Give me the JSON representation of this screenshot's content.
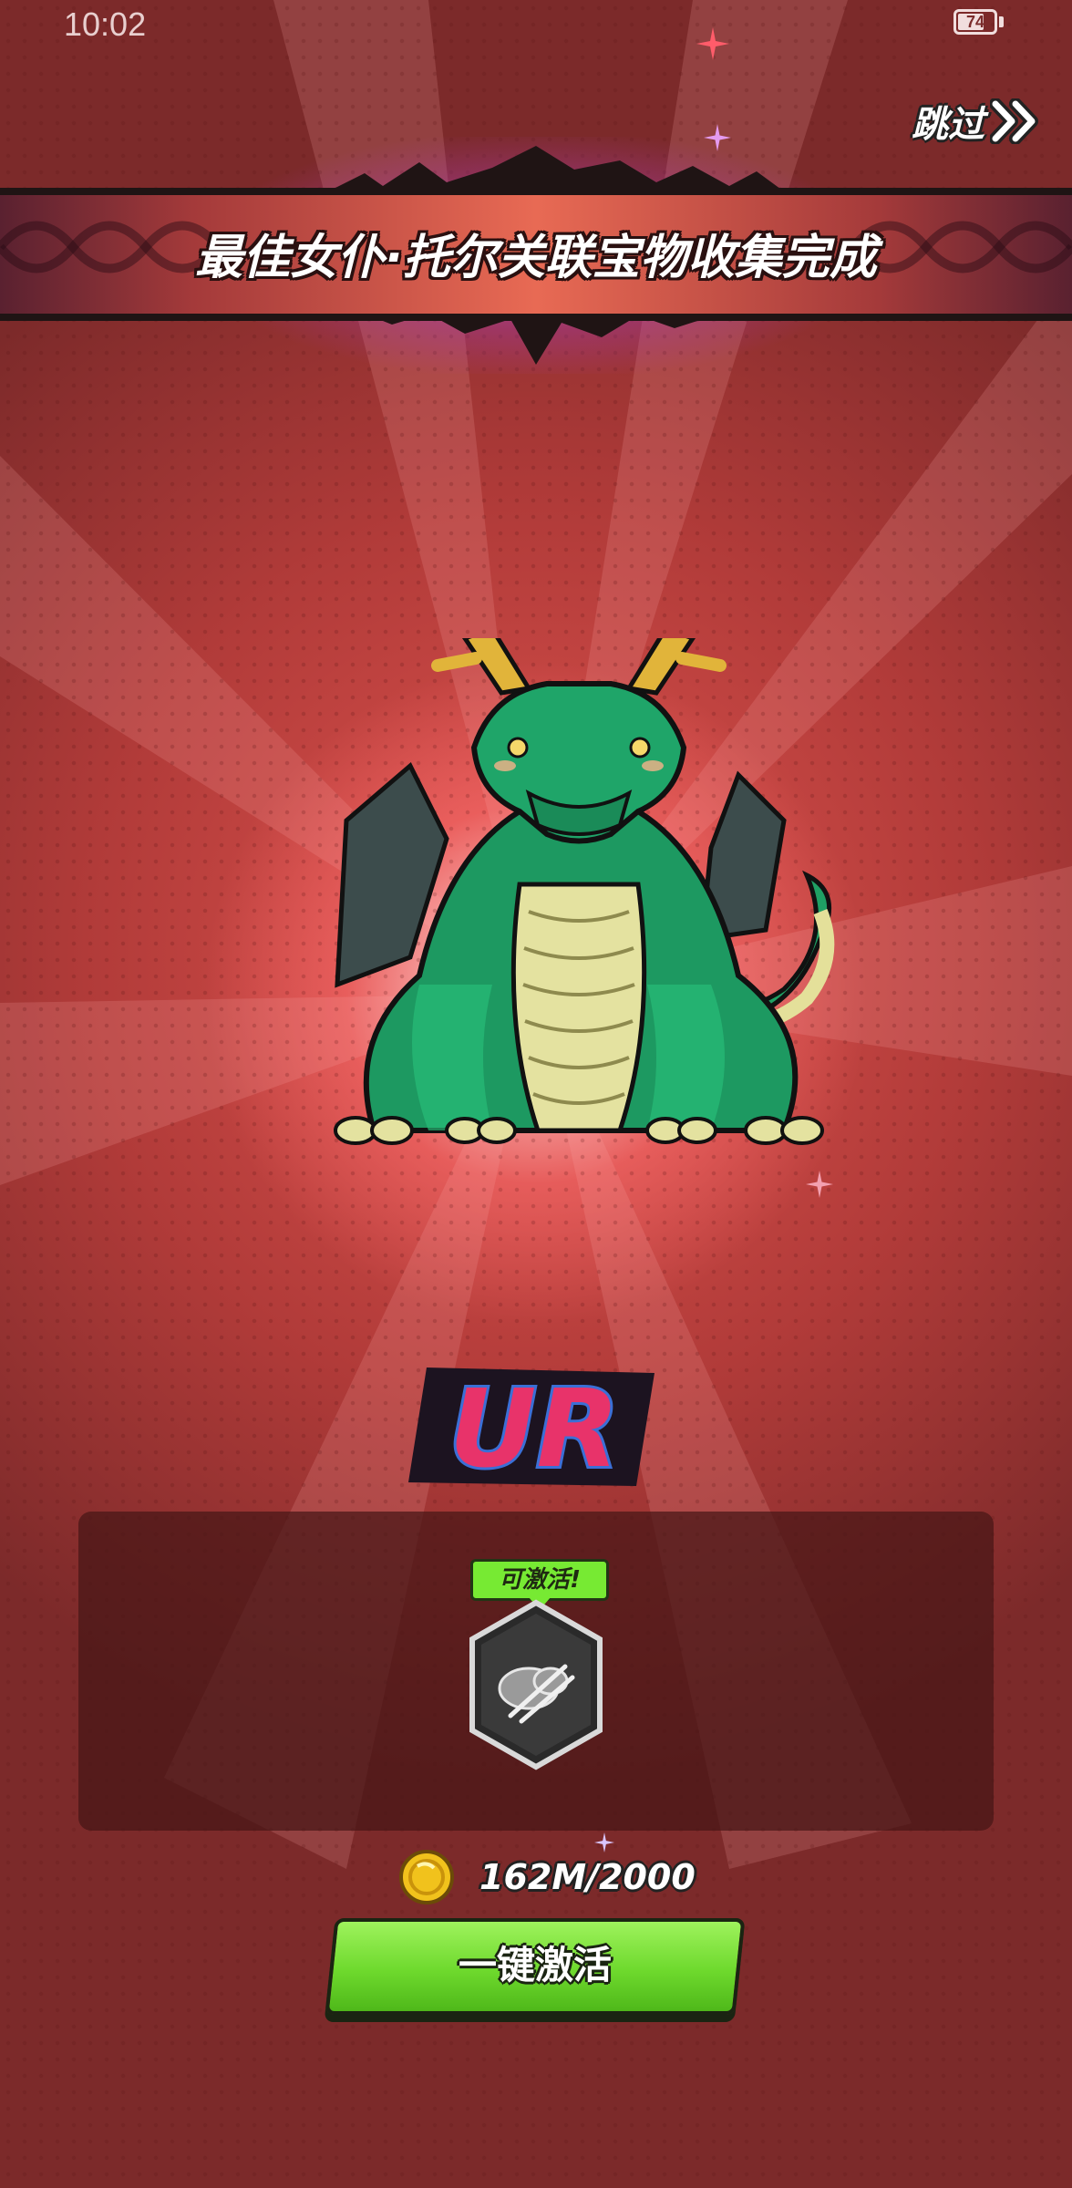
{
  "status_bar": {
    "time": "10:02",
    "battery": "74",
    "battery_level": 0.74
  },
  "skip": {
    "label": "跳过",
    "icon": "double-chevron-right-icon"
  },
  "banner": {
    "title": "最佳女仆·托尔关联宝物收集完成"
  },
  "creature": {
    "icon": "green-dragon-character"
  },
  "rarity": {
    "label": "UR",
    "colors": {
      "fill": "#e8336a",
      "highlight": "#ff6f9a",
      "outline": "#1c1320",
      "shadow": "#3b6fd6"
    }
  },
  "treasure_panel": {
    "status_tag": "可激活!",
    "item_icon": "treasure-item-icon"
  },
  "cost": {
    "icon": "gold-coin-icon",
    "value": "162M/2000"
  },
  "activate_button": {
    "label": "一键激活"
  },
  "colors": {
    "background": "#b13b39",
    "accent_green": "#77ea33",
    "banner_center": "#e86a54",
    "glow_purple": "#c85adc"
  }
}
